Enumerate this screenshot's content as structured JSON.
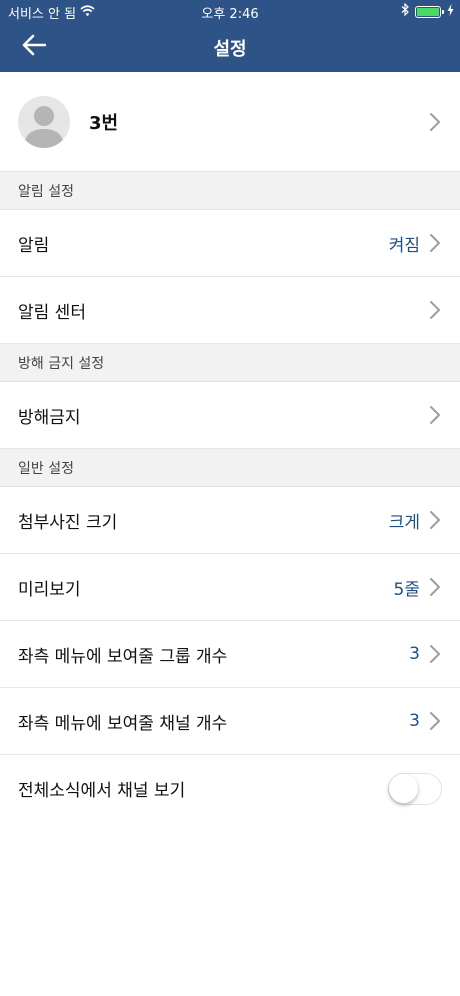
{
  "status_bar": {
    "carrier": "서비스 안 됨",
    "time": "오후 2:46",
    "battery_color": "#4cd964"
  },
  "nav": {
    "title": "설정",
    "back_icon": "arrow-left-icon",
    "background": "#2e5386"
  },
  "profile": {
    "name": "3번"
  },
  "sections": {
    "notifications": {
      "header": "알림 설정",
      "alarm": {
        "label": "알림",
        "value": "켜짐"
      },
      "alarm_center": {
        "label": "알림 센터"
      }
    },
    "dnd": {
      "header": "방해 금지 설정",
      "dnd": {
        "label": "방해금지"
      }
    },
    "general": {
      "header": "일반 설정",
      "photo_size": {
        "label": "첨부사진 크기",
        "value": "크게"
      },
      "preview": {
        "label": "미리보기",
        "value": "5줄"
      },
      "group_count": {
        "label": "좌측 메뉴에 보여줄 그룹 개수",
        "value": "3"
      },
      "channel_count": {
        "label": "좌측 메뉴에 보여줄 채널 개수",
        "value": "3"
      },
      "show_channels": {
        "label": "전체소식에서 채널 보기",
        "enabled": false
      }
    }
  },
  "accent_color": "#1f4e86"
}
